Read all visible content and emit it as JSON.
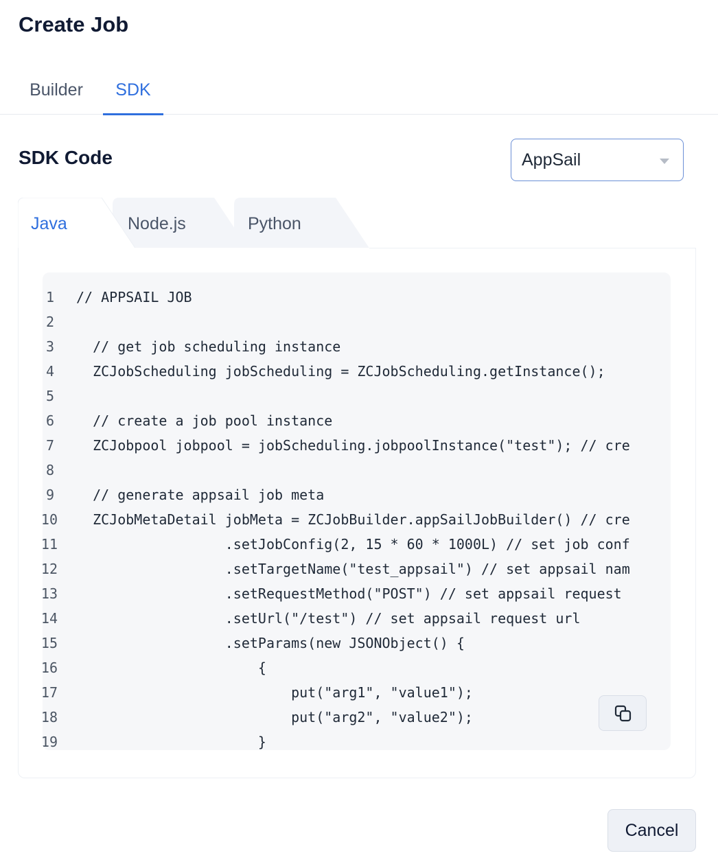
{
  "page": {
    "title": "Create Job"
  },
  "top_tabs": [
    {
      "label": "Builder",
      "active": false
    },
    {
      "label": "SDK",
      "active": true
    }
  ],
  "sdk": {
    "section_title": "SDK Code",
    "target_select": {
      "value": "AppSail"
    },
    "language_tabs": [
      {
        "label": "Java",
        "active": true
      },
      {
        "label": "Node.js",
        "active": false
      },
      {
        "label": "Python",
        "active": false
      }
    ],
    "code_lines": [
      {
        "number": "1",
        "text": "// APPSAIL JOB"
      },
      {
        "number": "2",
        "text": ""
      },
      {
        "number": "3",
        "text": "  // get job scheduling instance"
      },
      {
        "number": "4",
        "text": "  ZCJobScheduling jobScheduling = ZCJobScheduling.getInstance();"
      },
      {
        "number": "5",
        "text": ""
      },
      {
        "number": "6",
        "text": "  // create a job pool instance"
      },
      {
        "number": "7",
        "text": "  ZCJobpool jobpool = jobScheduling.jobpoolInstance(\"test\"); // cre"
      },
      {
        "number": "8",
        "text": ""
      },
      {
        "number": "9",
        "text": "  // generate appsail job meta"
      },
      {
        "number": "10",
        "text": "  ZCJobMetaDetail jobMeta = ZCJobBuilder.appSailJobBuilder() // cre"
      },
      {
        "number": "11",
        "text": "                  .setJobConfig(2, 15 * 60 * 1000L) // set job conf"
      },
      {
        "number": "12",
        "text": "                  .setTargetName(\"test_appsail\") // set appsail nam"
      },
      {
        "number": "13",
        "text": "                  .setRequestMethod(\"POST\") // set appsail request "
      },
      {
        "number": "14",
        "text": "                  .setUrl(\"/test\") // set appsail request url"
      },
      {
        "number": "15",
        "text": "                  .setParams(new JSONObject() {"
      },
      {
        "number": "16",
        "text": "                      {"
      },
      {
        "number": "17",
        "text": "                          put(\"arg1\", \"value1\");"
      },
      {
        "number": "18",
        "text": "                          put(\"arg2\", \"value2\");"
      },
      {
        "number": "19",
        "text": "                      }"
      }
    ],
    "copy_icon": "copy-icon"
  },
  "footer": {
    "cancel_label": "Cancel"
  }
}
